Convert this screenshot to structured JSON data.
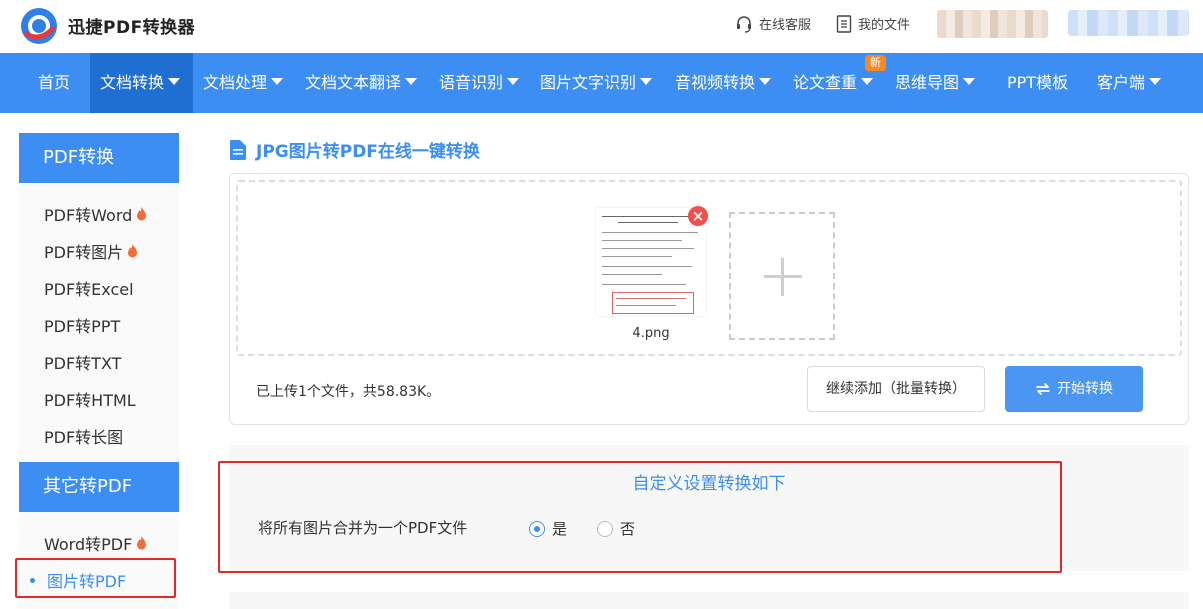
{
  "header": {
    "brand": "迅捷PDF转换器",
    "online_service": "在线客服",
    "my_files": "我的文件"
  },
  "nav": {
    "items": [
      {
        "label": "首页",
        "has_caret": false
      },
      {
        "label": "文档转换",
        "has_caret": true,
        "active": true
      },
      {
        "label": "文档处理",
        "has_caret": true
      },
      {
        "label": "文档文本翻译",
        "has_caret": true
      },
      {
        "label": "语音识别",
        "has_caret": true
      },
      {
        "label": "图片文字识别",
        "has_caret": true
      },
      {
        "label": "音视频转换",
        "has_caret": true
      },
      {
        "label": "论文查重",
        "has_caret": true
      },
      {
        "label": "思维导图",
        "has_caret": true
      },
      {
        "label": "PPT模板",
        "has_caret": false
      },
      {
        "label": "客户端",
        "has_caret": true
      }
    ],
    "new_badge": "新"
  },
  "sidebar": {
    "section1_title": "PDF转换",
    "section1_items": [
      {
        "label": "PDF转Word",
        "hot": true
      },
      {
        "label": "PDF转图片",
        "hot": true
      },
      {
        "label": "PDF转Excel",
        "hot": false
      },
      {
        "label": "PDF转PPT",
        "hot": false
      },
      {
        "label": "PDF转TXT",
        "hot": false
      },
      {
        "label": "PDF转HTML",
        "hot": false
      },
      {
        "label": "PDF转长图",
        "hot": false
      }
    ],
    "section2_title": "其它转PDF",
    "section2_items": [
      {
        "label": "Word转PDF",
        "hot": true
      },
      {
        "label": "图片转PDF",
        "hot": false,
        "active": true
      }
    ]
  },
  "main": {
    "title": "JPG图片转PDF在线一键转换",
    "file_name": "4.png",
    "upload_status": "已上传1个文件，共58.83K。",
    "continue_add_button": "继续添加（批量转换）",
    "start_button": "开始转换"
  },
  "settings": {
    "title": "自定义设置转换如下",
    "merge_label": "将所有图片合并为一个PDF文件",
    "option_yes": "是",
    "option_no": "否",
    "selected": "是"
  },
  "colors": {
    "accent": "#3d8ef2",
    "nav_active": "#1f6ed1",
    "highlight_red": "#e02a2a",
    "badge_orange": "#f58a25"
  }
}
